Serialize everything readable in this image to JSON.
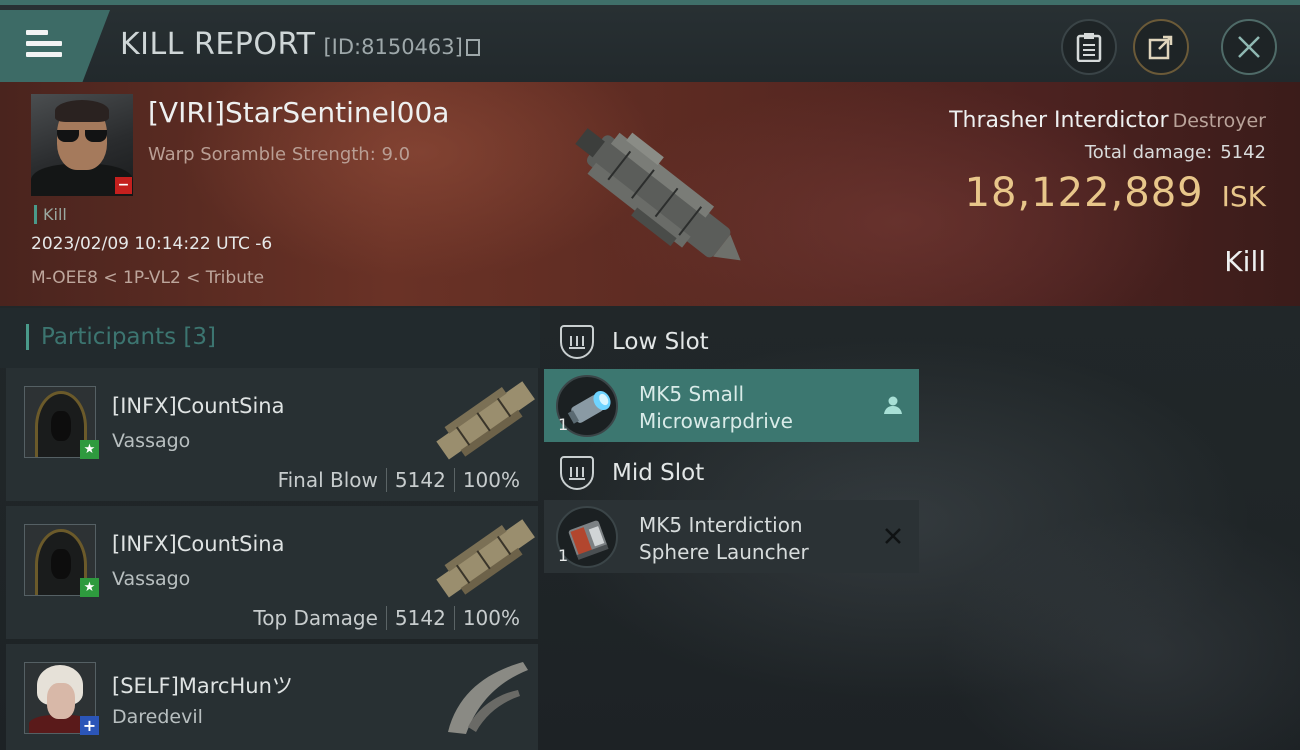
{
  "header": {
    "title": "KILL REPORT",
    "report_id": "[ID:8150463]",
    "buttons": [
      "clipboard-icon",
      "share-icon",
      "close-icon"
    ],
    "accent_color": "#3d6b66"
  },
  "victim": {
    "name": "[VIRI]StarSentinel00a",
    "scramble": "Warp Soramble Strength: 9.0",
    "status_tag": "Kill",
    "datetime": "2023/02/09 10:14:22 UTC -6",
    "location": "M-OEE8 < 1P-VL2 < Tribute",
    "ship_name": "Thrasher Interdictor",
    "ship_class": "Destroyer",
    "total_damage_label": "Total damage:",
    "total_damage": "5142",
    "isk_value": "18,122,889",
    "isk_unit": "ISK",
    "result": "Kill",
    "isk_color": "#e8c68a"
  },
  "participants": {
    "title": "Participants [3]",
    "rows": [
      {
        "name": "[INFX]CountSina",
        "ship": "Vassago",
        "role": "Final Blow",
        "damage": "5142",
        "percent": "100%",
        "badge": "★"
      },
      {
        "name": "[INFX]CountSina",
        "ship": "Vassago",
        "role": "Top Damage",
        "damage": "5142",
        "percent": "100%",
        "badge": "★"
      },
      {
        "name": "[SELF]MarcHunツ",
        "ship": "Daredevil",
        "badge": "+"
      }
    ]
  },
  "fitting": {
    "low_slot": {
      "label": "Low Slot",
      "modules": [
        {
          "line1": "MK5 Small",
          "line2": "Microwarpdrive",
          "qty": "1",
          "status": "dropped"
        }
      ]
    },
    "mid_slot": {
      "label": "Mid Slot",
      "modules": [
        {
          "line1": "MK5 Interdiction",
          "line2": "Sphere Launcher",
          "qty": "1",
          "status": "destroyed"
        }
      ]
    }
  }
}
